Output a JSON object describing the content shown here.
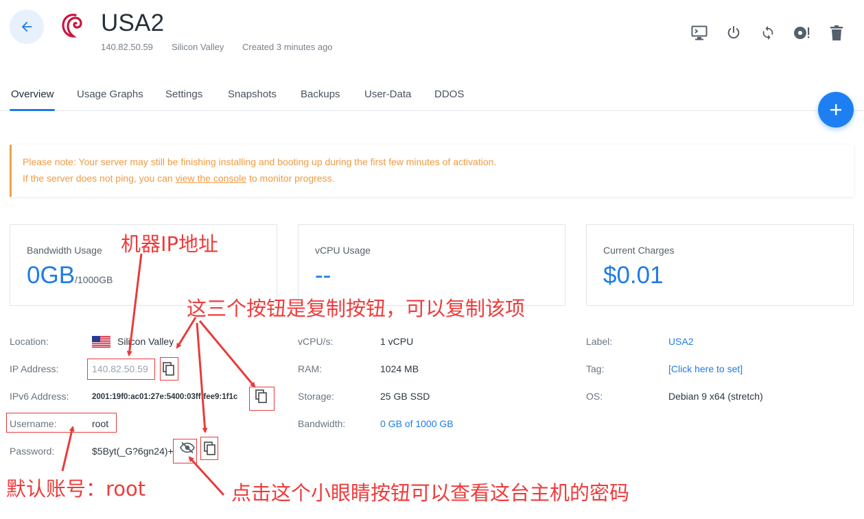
{
  "header": {
    "title": "USA2",
    "ip": "140.82.50.59",
    "location": "Silicon Valley",
    "created": "Created 3 minutes ago",
    "actions": [
      "console-icon",
      "power-icon",
      "restart-icon",
      "reinstall-icon",
      "delete-icon"
    ]
  },
  "tabs": [
    "Overview",
    "Usage Graphs",
    "Settings",
    "Snapshots",
    "Backups",
    "User-Data",
    "DDOS"
  ],
  "notice": {
    "line1": "Please note: Your server may still be finishing installing and booting up during the first few minutes of activation.",
    "line2_before": "If the server does not ping, you can ",
    "line2_link": "view the console",
    "line2_after": " to monitor progress."
  },
  "cards": {
    "bandwidth": {
      "label": "Bandwidth Usage",
      "value": "0GB",
      "unit": "/1000GB"
    },
    "vcpu": {
      "label": "vCPU Usage",
      "value": "--"
    },
    "charges": {
      "label": "Current Charges",
      "value": "$0.01"
    }
  },
  "details": {
    "location_label": "Location:",
    "location_value": "Silicon Valley",
    "ip_label": "IP Address:",
    "ip_value": "140.82.50.59",
    "ipv6_label": "IPv6 Address:",
    "ipv6_value": "2001:19f0:ac01:27e:5400:03ff:fee9:1f1c",
    "username_label": "Username:",
    "username_value": "root",
    "password_label": "Password:",
    "password_value": "$5Byt(_G?6gn24)+",
    "vcpus_label": "vCPU/s:",
    "vcpus_value": "1 vCPU",
    "ram_label": "RAM:",
    "ram_value": "1024 MB",
    "storage_label": "Storage:",
    "storage_value": "25 GB SSD",
    "bandwidth_label": "Bandwidth:",
    "bandwidth_value": "0 GB of 1000 GB",
    "label_label": "Label:",
    "label_value": "USA2",
    "tag_label": "Tag:",
    "tag_value": "[Click here to set]",
    "os_label": "OS:",
    "os_value": "Debian 9 x64 (stretch)"
  },
  "annotations": {
    "ip_note": "机器IP地址",
    "copy_note": "这三个按钮是复制按钮，可以复制该项",
    "account_note": "默认账号：root",
    "eye_note": "点击这个小眼睛按钮可以查看这台主机的密码"
  },
  "colors": {
    "accent": "#1e7be6",
    "warning": "#ef9a41",
    "annotation": "#e83a3a"
  }
}
